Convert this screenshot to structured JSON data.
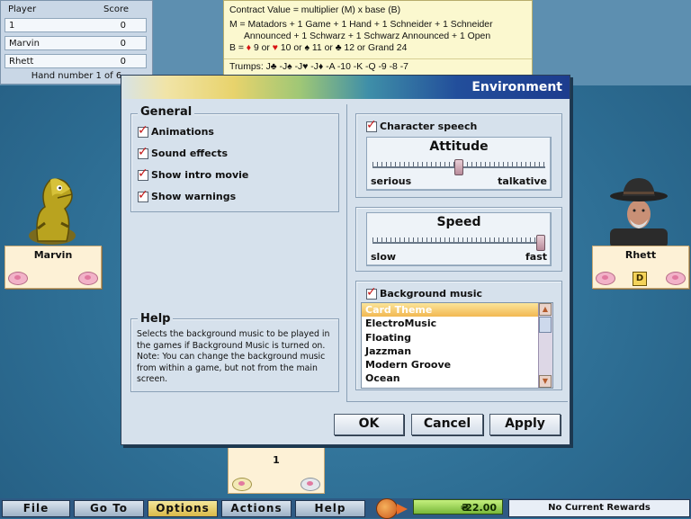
{
  "score_panel": {
    "col_player": "Player",
    "col_score": "Score",
    "rows": [
      {
        "player": "1",
        "score": "0"
      },
      {
        "player": "Marvin",
        "score": "0"
      },
      {
        "player": "Rhett",
        "score": "0"
      }
    ],
    "hand_info": "Hand number 1 of 6"
  },
  "contract": {
    "line1": "Contract Value = multiplier (M) x base (B)",
    "line2": "M = Matadors + 1 Game + 1 Hand + 1 Schneider + 1 Schneider",
    "line3": "Announced + 1 Schwarz + 1 Schwarz Announced + 1 Open",
    "line4_prefix": "B =",
    "base": [
      {
        "suit": "diamonds-icon",
        "value": "9",
        "sep": "or"
      },
      {
        "suit": "hearts-icon",
        "value": "10",
        "sep": "or"
      },
      {
        "suit": "spades-icon",
        "value": "11",
        "sep": "or"
      },
      {
        "suit": "clubs-icon",
        "value": "12",
        "sep": "or"
      }
    ],
    "grand_label": "Grand",
    "grand_value": "24",
    "trumps_label": "Trumps:",
    "trumps": "J♣ -J♠ -J♥ -J♦ -A -10 -K -Q -9 -8 -7"
  },
  "players": {
    "left": {
      "name": "Marvin"
    },
    "right": {
      "name": "Rhett",
      "dealer_badge": "D"
    },
    "bottom": {
      "name": "1"
    }
  },
  "dialog": {
    "title": "Environment",
    "general": {
      "title": "General",
      "options": [
        {
          "label": "Animations",
          "checked": true
        },
        {
          "label": "Sound effects",
          "checked": true
        },
        {
          "label": "Show intro movie",
          "checked": true
        },
        {
          "label": "Show warnings",
          "checked": true
        }
      ]
    },
    "character_speech": {
      "label": "Character speech",
      "checked": true
    },
    "attitude": {
      "title": "Attitude",
      "low": "serious",
      "high": "talkative",
      "level": 0.5
    },
    "speed": {
      "title": "Speed",
      "low": "slow",
      "high": "fast",
      "level": 1.0
    },
    "background_music": {
      "label": "Background music",
      "checked": true,
      "items": [
        "Card Theme",
        "ElectroMusic",
        "Floating",
        "Jazzman",
        "Modern Groove",
        "Ocean"
      ],
      "selected": "Card Theme"
    },
    "help": {
      "title": "Help",
      "text": "Selects the background music to be played in the games if Background Music is turned on. Note: You can change the background music from within a game, but not from the main screen."
    },
    "buttons": {
      "ok": "OK",
      "cancel": "Cancel",
      "apply": "Apply"
    }
  },
  "menu": {
    "file": "File",
    "goto": "Go To",
    "options": "Options",
    "actions": "Actions",
    "help": "Help",
    "active": "Options"
  },
  "status": {
    "money": "22.00",
    "rewards": "No Current Rewards"
  },
  "colors": {
    "accent": "#1d3c8e",
    "check": "#c51919",
    "selection": "#f2b852"
  }
}
